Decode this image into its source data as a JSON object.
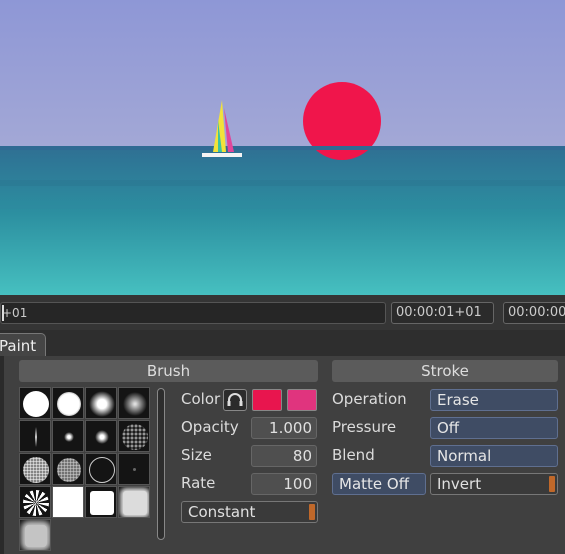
{
  "viewer": {
    "sky_color": "#8f98d4",
    "sea_color": "#2f8a9e",
    "sun_color": "#f0154b"
  },
  "timeline": {
    "frame_label": "+01",
    "timecode_current": "00:00:01+01",
    "timecode_next": "00:00:00"
  },
  "tabs": [
    {
      "label": "Paint"
    }
  ],
  "brush": {
    "header": "Brush",
    "color_label": "Color",
    "color_primary": "#e8154e",
    "color_secondary": "#e0347e",
    "opacity_label": "Opacity",
    "opacity_value": "1.000",
    "size_label": "Size",
    "size_value": "80",
    "rate_label": "Rate",
    "rate_value": "100",
    "mode_value": "Constant"
  },
  "stroke": {
    "header": "Stroke",
    "operation_label": "Operation",
    "operation_value": "Erase",
    "pressure_label": "Pressure",
    "pressure_value": "Off",
    "blend_label": "Blend",
    "blend_value": "Normal",
    "matte_label": "Matte Off",
    "invert_label": "Invert"
  }
}
